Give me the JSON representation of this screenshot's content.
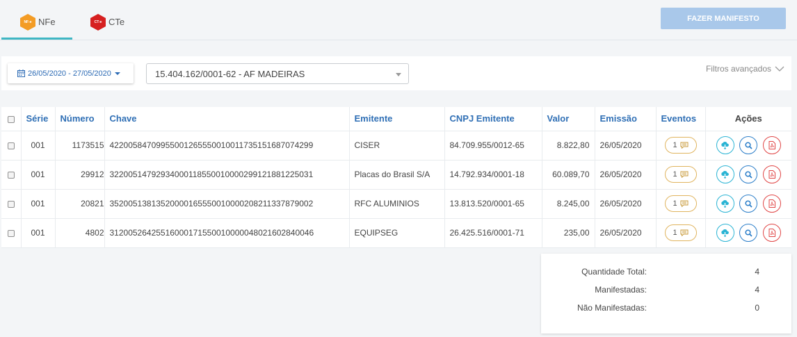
{
  "tabs": [
    {
      "badge": "NF-e",
      "label": "NFe",
      "active": true,
      "color": "#f39c25"
    },
    {
      "badge": "CT-e",
      "label": "CTe",
      "active": false,
      "color": "#d62020"
    }
  ],
  "toolbar": {
    "manifest_label": "FAZER MANIFESTO"
  },
  "filters": {
    "date_range": "26/05/2020 - 27/05/2020",
    "company": "15.404.162/0001-62 - AF MADEIRAS",
    "advanced_label": "Filtros avançados"
  },
  "table": {
    "headers": {
      "serie": "Série",
      "numero": "Número",
      "chave": "Chave",
      "emitente": "Emitente",
      "cnpj": "CNPJ Emitente",
      "valor": "Valor",
      "emissao": "Emissão",
      "eventos": "Eventos",
      "acoes": "Ações"
    },
    "rows": [
      {
        "serie": "001",
        "numero": "1173515",
        "chave": "42200584709955001265550010011735151687074299",
        "emitente": "CISER",
        "cnpj": "84.709.955/0012-65",
        "valor": "8.822,80",
        "emissao": "26/05/2020",
        "eventos": "1"
      },
      {
        "serie": "001",
        "numero": "29912",
        "chave": "32200514792934000118550010000299121881225031",
        "emitente": "Placas do Brasil S/A",
        "cnpj": "14.792.934/0001-18",
        "valor": "60.089,70",
        "emissao": "26/05/2020",
        "eventos": "1"
      },
      {
        "serie": "001",
        "numero": "20821",
        "chave": "35200513813520000165550010000208211337879002",
        "emitente": "RFC ALUMINIOS",
        "cnpj": "13.813.520/0001-65",
        "valor": "8.245,00",
        "emissao": "26/05/2020",
        "eventos": "1"
      },
      {
        "serie": "001",
        "numero": "4802",
        "chave": "31200526425516000171550010000048021602840046",
        "emitente": "EQUIPSEG",
        "cnpj": "26.425.516/0001-71",
        "valor": "235,00",
        "emissao": "26/05/2020",
        "eventos": "1"
      }
    ]
  },
  "summary": {
    "total_label": "Quantidade Total:",
    "total": "4",
    "manifested_label": "Manifestadas:",
    "manifested": "4",
    "not_manifested_label": "Não Manifestadas:",
    "not_manifested": "0"
  },
  "icons": {
    "calendar": "calendar-icon",
    "chevron": "chevron-down-icon",
    "comment": "comment-icon",
    "cloud": "cloud-download-icon",
    "search": "search-icon",
    "pdf": "pdf-icon"
  }
}
